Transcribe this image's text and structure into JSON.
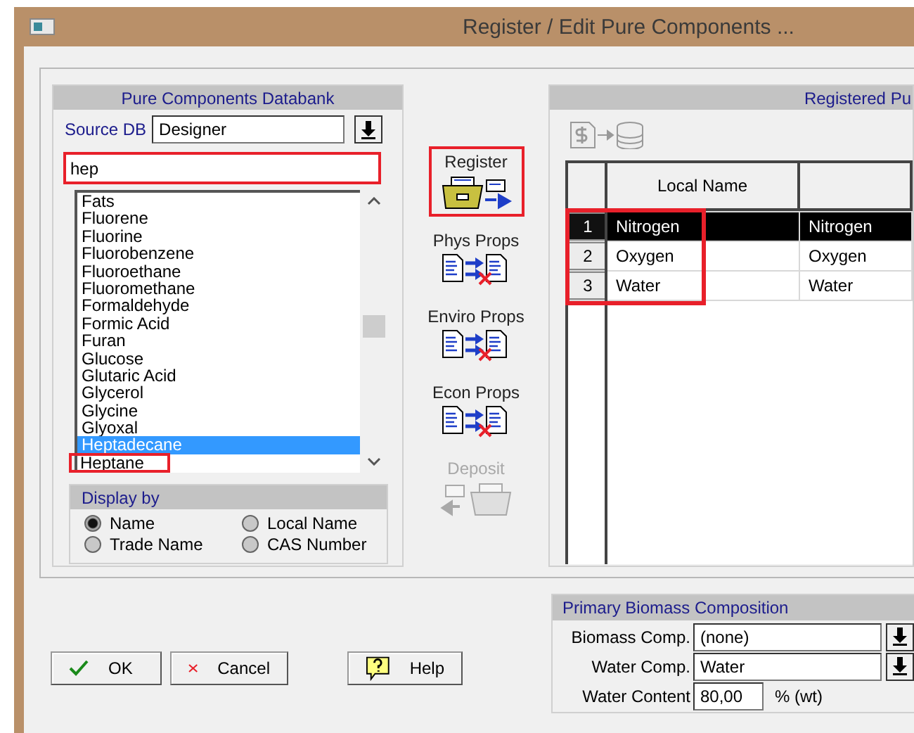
{
  "window": {
    "title": "Register / Edit Pure Components ..."
  },
  "databank": {
    "title": "Pure Components Databank",
    "source_label": "Source DB",
    "source_value": "Designer",
    "search_value": "hep",
    "search_highlighted": true,
    "items": [
      {
        "label": "Fats",
        "selected": false,
        "highlighted": false
      },
      {
        "label": "Fluorene",
        "selected": false,
        "highlighted": false
      },
      {
        "label": "Fluorine",
        "selected": false,
        "highlighted": false
      },
      {
        "label": "Fluorobenzene",
        "selected": false,
        "highlighted": false
      },
      {
        "label": "Fluoroethane",
        "selected": false,
        "highlighted": false
      },
      {
        "label": "Fluoromethane",
        "selected": false,
        "highlighted": false
      },
      {
        "label": "Formaldehyde",
        "selected": false,
        "highlighted": false
      },
      {
        "label": "Formic Acid",
        "selected": false,
        "highlighted": false
      },
      {
        "label": "Furan",
        "selected": false,
        "highlighted": false
      },
      {
        "label": "Glucose",
        "selected": false,
        "highlighted": false
      },
      {
        "label": "Glutaric Acid",
        "selected": false,
        "highlighted": false
      },
      {
        "label": "Glycerol",
        "selected": false,
        "highlighted": false
      },
      {
        "label": "Glycine",
        "selected": false,
        "highlighted": false
      },
      {
        "label": "Glyoxal",
        "selected": false,
        "highlighted": false
      },
      {
        "label": "Heptadecane",
        "selected": true,
        "highlighted": false
      },
      {
        "label": "Heptane",
        "selected": false,
        "highlighted": true
      }
    ],
    "display_by": {
      "title": "Display by",
      "options": [
        {
          "label": "Name",
          "selected": true
        },
        {
          "label": "Local Name",
          "selected": false
        },
        {
          "label": "Trade Name",
          "selected": false
        },
        {
          "label": "CAS Number",
          "selected": false
        }
      ]
    }
  },
  "actions": [
    {
      "label": "Register",
      "kind": "register",
      "disabled": false,
      "highlighted": true
    },
    {
      "label": "Phys Props",
      "kind": "props",
      "disabled": false,
      "highlighted": false
    },
    {
      "label": "Enviro Props",
      "kind": "props",
      "disabled": false,
      "highlighted": false
    },
    {
      "label": "Econ Props",
      "kind": "props",
      "disabled": false,
      "highlighted": false
    },
    {
      "label": "Deposit",
      "kind": "deposit",
      "disabled": true,
      "highlighted": false
    }
  ],
  "registered": {
    "title": "Registered Pu",
    "columns": [
      "Local Name"
    ],
    "rows_highlighted": true,
    "rows": [
      {
        "number": "1",
        "cells": [
          "Nitrogen",
          "Nitrogen"
        ],
        "selected": true
      },
      {
        "number": "2",
        "cells": [
          "Oxygen",
          "Oxygen"
        ],
        "selected": false
      },
      {
        "number": "3",
        "cells": [
          "Water",
          "Water"
        ],
        "selected": false
      }
    ]
  },
  "buttons": [
    {
      "label": "OK",
      "kind": "ok"
    },
    {
      "label": "Cancel",
      "kind": "cancel"
    },
    {
      "label": "Help",
      "kind": "help"
    }
  ],
  "biomass": {
    "title": "Primary Biomass Composition",
    "fields": [
      {
        "label": "Biomass Comp.",
        "value": "(none)",
        "kind": "dropdown"
      },
      {
        "label": "Water Comp.",
        "value": "Water",
        "kind": "dropdown"
      },
      {
        "label": "Water Content",
        "value": "80,00",
        "unit": "% (wt)",
        "kind": "number"
      }
    ]
  }
}
